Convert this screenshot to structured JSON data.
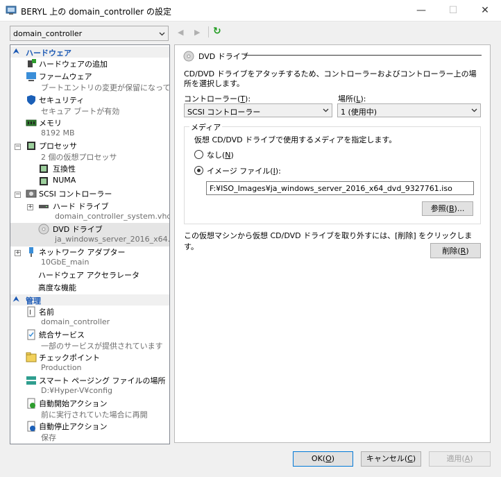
{
  "window": {
    "title": "BERYL 上の domain_controller の設定",
    "minimize": "—",
    "maximize": "☐",
    "close": "✕"
  },
  "vm_selector": {
    "value": "domain_controller"
  },
  "toolbar": {
    "back": "◀",
    "forward": "▶",
    "refresh": "↻"
  },
  "tree": {
    "hardware_header": "ハードウェア",
    "management_header": "管理",
    "items": {
      "add_hardware": "ハードウェアの追加",
      "firmware": "ファームウェア",
      "firmware_sub": "ブートエントリの変更が保留になって...",
      "security": "セキュリティ",
      "security_sub": "セキュア ブートが有効",
      "memory": "メモリ",
      "memory_sub": "8192 MB",
      "processor": "プロセッサ",
      "processor_sub": "2 個の仮想プロセッサ",
      "compat": "互換性",
      "numa": "NUMA",
      "scsi": "SCSI コントローラー",
      "hdd": "ハード ドライブ",
      "hdd_sub": "domain_controller_system.vhdx",
      "dvd": "DVD ドライブ",
      "dvd_sub": "ja_windows_server_2016_x64...",
      "nic": "ネットワーク アダプター",
      "nic_sub": "10GbE_main",
      "accel": "ハードウェア アクセラレータ",
      "advanced": "高度な機能",
      "name": "名前",
      "name_sub": "domain_controller",
      "integration": "統合サービス",
      "integration_sub": "一部のサービスが提供されています",
      "checkpoint": "チェックポイント",
      "checkpoint_sub": "Production",
      "paging": "スマート ページング ファイルの場所",
      "paging_sub": "D:¥Hyper-V¥config",
      "autostart": "自動開始アクション",
      "autostart_sub": "前に実行されていた場合に再開",
      "autostop": "自動停止アクション",
      "autostop_sub": "保存"
    }
  },
  "panel": {
    "section_title": "DVD ドライブ",
    "description": "CD/DVD ドライブをアタッチするため、コントローラーおよびコントローラー上の場所を選択します。",
    "controller_label": "コントローラー(",
    "controller_key": "T",
    "controller_label_end": "):",
    "controller_value": "SCSI コントローラー",
    "location_label": "場所(",
    "location_key": "L",
    "location_label_end": "):",
    "location_value": "1 (使用中)",
    "media_legend": "メディア",
    "media_desc": "仮想 CD/DVD ドライブで使用するメディアを指定します。",
    "none_label": "なし(",
    "none_key": "N",
    "none_end": ")",
    "image_label": "イメージ ファイル(",
    "image_key": "I",
    "image_end": "):",
    "image_path": "F:¥ISO_Images¥ja_windows_server_2016_x64_dvd_9327761.iso",
    "browse_label": "参照(",
    "browse_key": "B",
    "browse_end": ")...",
    "remove_desc": "この仮想マシンから仮想 CD/DVD ドライブを取り外すには、[削除] をクリックします。",
    "remove_label": "削除(",
    "remove_key": "R",
    "remove_end": ")"
  },
  "footer": {
    "ok_label": "OK(",
    "ok_key": "O",
    "ok_end": ")",
    "cancel_label": "キャンセル(",
    "cancel_key": "C",
    "cancel_end": ")",
    "apply_label": "適用(",
    "apply_key": "A",
    "apply_end": ")"
  }
}
